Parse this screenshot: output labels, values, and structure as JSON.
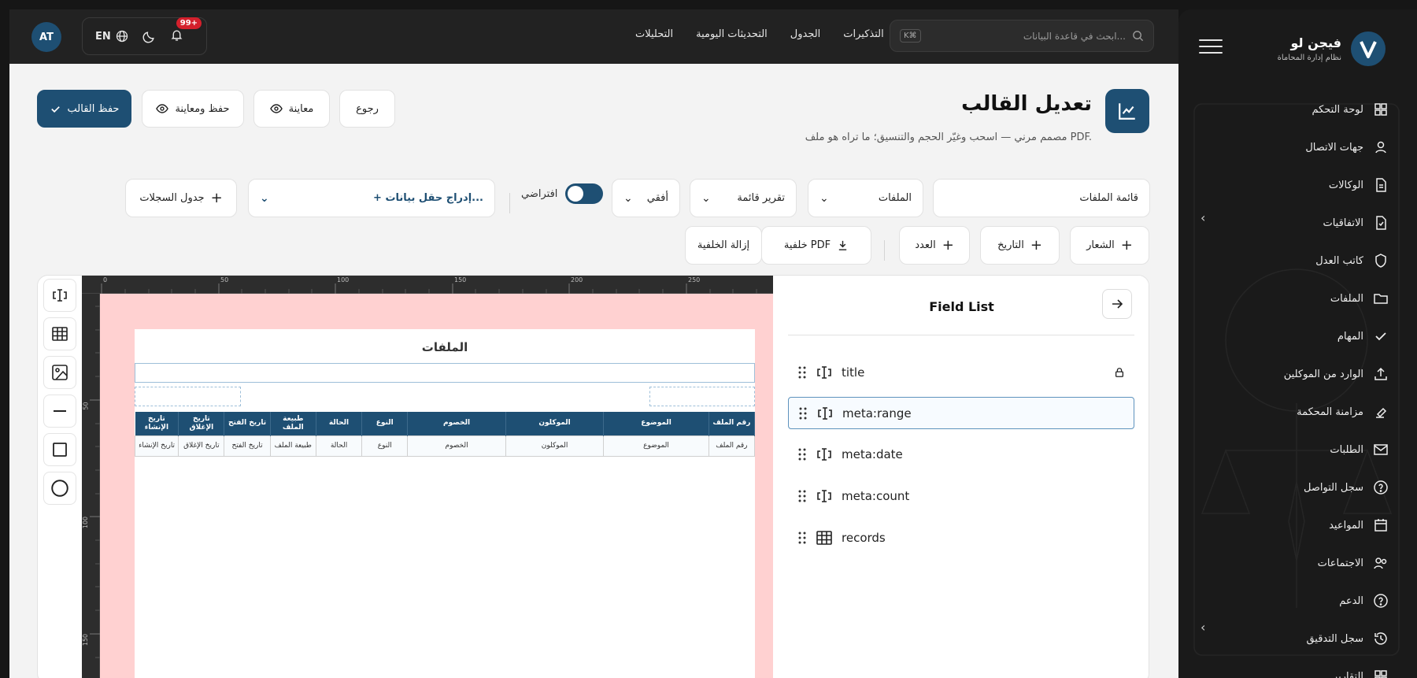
{
  "sidebar": {
    "brand_name": "فيجن لو",
    "brand_sub": "نظام إدارة المحاماة",
    "items": [
      {
        "label": "لوحة التحكم",
        "icon": "dashboard-icon"
      },
      {
        "label": "جهات الاتصال",
        "icon": "user-icon"
      },
      {
        "label": "الوكالات",
        "icon": "document-icon"
      },
      {
        "label": "الاتفاقيات",
        "icon": "file-check-icon"
      },
      {
        "label": "كاتب العدل",
        "icon": "shield-icon"
      },
      {
        "label": "الملفات",
        "icon": "folder-icon"
      },
      {
        "label": "المهام",
        "icon": "check-icon"
      },
      {
        "label": "الوارد من الموكلين",
        "icon": "upload-icon"
      },
      {
        "label": "مزامنة المحكمة",
        "icon": "gavel-icon"
      },
      {
        "label": "الطلبات",
        "icon": "mail-icon"
      },
      {
        "label": "سجل التواصل",
        "icon": "help-circle-icon"
      },
      {
        "label": "المواعيد",
        "icon": "calendar-icon"
      },
      {
        "label": "الاجتماعات",
        "icon": "users-icon"
      },
      {
        "label": "الدعم",
        "icon": "help-circle-icon"
      },
      {
        "label": "سجل التدقيق",
        "icon": "history-icon"
      },
      {
        "label": "التقارير",
        "icon": "grid-icon"
      }
    ]
  },
  "topbar": {
    "avatar_initials": "AT",
    "language": "EN",
    "notification_count": "99+",
    "nav": [
      "التذكيرات",
      "الجدول",
      "التحديثات اليومية",
      "التحليلات"
    ],
    "search_placeholder": "ابحث في قاعدة البيانات...",
    "search_shortcut": "K⌘"
  },
  "page": {
    "title": "تعديل القالب",
    "subtitle": "مصمم مرني — اسحب وغيّر الحجم والتنسيق؛ ما تراه هو ملف PDF.",
    "buttons": {
      "save": "حفظ القالب",
      "save_preview": "حفظ ومعاينة",
      "preview": "معاينة",
      "back": "رجوع"
    }
  },
  "controls": {
    "template_name": "قائمة الملفات",
    "module": "الملفات",
    "report_type": "تقرير قائمة",
    "orientation": "أفقي",
    "default_label": "افتراضي",
    "insert_field": "+ إدراج حقل بيانات...",
    "records_table": "جدول السجلات",
    "logo": "الشعار",
    "date": "التاريخ",
    "count": "العدد",
    "pdf_background": "خلفية PDF",
    "remove_background": "إزالة الخلفية"
  },
  "canvas": {
    "ruler_top": [
      "0",
      "50",
      "100",
      "150",
      "200",
      "250"
    ],
    "ruler_left": [
      "50",
      "100",
      "150"
    ],
    "pdf_title": "الملفات",
    "table_headers": [
      "رقم الملف",
      "الموضوع",
      "الموكلون",
      "الخصوم",
      "النوع",
      "الحالة",
      "طبيعة الملف",
      "تاريخ الفتح",
      "تاريخ الإغلاق",
      "تاريخ الإنشاء"
    ],
    "table_row": [
      "رقم الملف",
      "الموضوع",
      "الموكلون",
      "الخصوم",
      "النوع",
      "الحالة",
      "طبيعة الملف",
      "تاريخ الفتح",
      "تاريخ الإغلاق",
      "تاريخ الإنشاء"
    ]
  },
  "field_list": {
    "title": "Field List",
    "items": [
      {
        "label": "title",
        "icon": "text-field-icon",
        "locked": true
      },
      {
        "label": "meta:range",
        "icon": "text-field-icon",
        "selected": true
      },
      {
        "label": "meta:date",
        "icon": "text-field-icon"
      },
      {
        "label": "meta:count",
        "icon": "text-field-icon"
      },
      {
        "label": "records",
        "icon": "table-icon"
      }
    ]
  },
  "colors": {
    "brand": "#1e4f73",
    "sidebar_bg": "#1a1a1a",
    "topbar_bg": "#222222",
    "badge": "#d4202c",
    "margin_zone": "#ffd1d1"
  }
}
